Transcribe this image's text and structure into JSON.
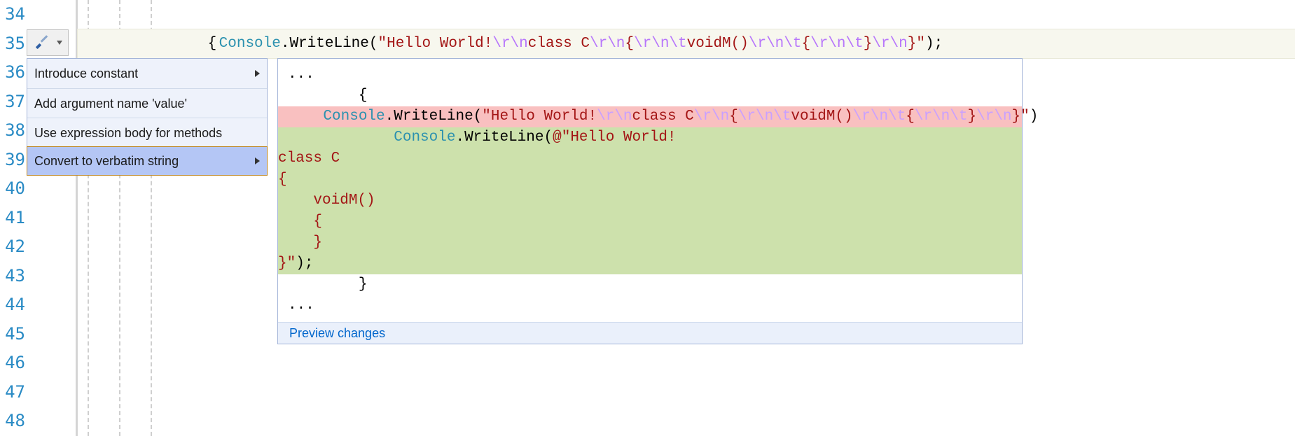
{
  "gutter": {
    "lines": [
      "34",
      "35",
      "36",
      "37",
      "38",
      "39",
      "40",
      "41",
      "42",
      "43",
      "44",
      "45",
      "46",
      "47",
      "48"
    ]
  },
  "code": {
    "line34_brace": "{",
    "line35": {
      "indent": "                ",
      "class": "Console",
      "dot": ".",
      "method": "WriteLine",
      "open": "(",
      "str_open": "\"",
      "s1": "Hello World!",
      "e1": "\\r\\n",
      "s2": "class C",
      "e2": "\\r\\n",
      "s3": "{",
      "e3": "\\r\\n\\t",
      "s4": "voidM()",
      "e4": "\\r\\n\\t",
      "s5": "{",
      "e5": "\\r\\n\\t",
      "s6": "}",
      "e6": "\\r\\n",
      "s7": "}",
      "str_close": "\"",
      "close": ")",
      "semi": ";"
    }
  },
  "bulb": {
    "icon": "screwdriver-icon"
  },
  "menu": {
    "items": [
      {
        "label": "Introduce constant",
        "has_submenu": true,
        "selected": false
      },
      {
        "label": "Add argument name 'value'",
        "has_submenu": false,
        "selected": false
      },
      {
        "label": "Use expression body for methods",
        "has_submenu": false,
        "selected": false
      },
      {
        "label": "Convert to verbatim string",
        "has_submenu": true,
        "selected": true
      }
    ]
  },
  "preview": {
    "ellipsis": "...",
    "brace_open_indented": "        {",
    "del": {
      "indent": "    ",
      "class": "Console",
      "dot": ".",
      "method": "WriteLine",
      "open": "(",
      "q": "\"",
      "s1": "Hello World!",
      "e1": "\\r\\n",
      "s2": "class C",
      "e2": "\\r\\n",
      "s3": "{",
      "e3": "\\r\\n\\t",
      "s4": "voidM()",
      "e4": "\\r\\n\\t",
      "s5": "{",
      "e5": "\\r\\n\\t",
      "s6": "}",
      "e6": "\\r\\n",
      "s7": "}",
      "qclose": "\"",
      "close": ")"
    },
    "add": {
      "line1_prefix": "            ",
      "line1_class": "Console",
      "line1_dot": ".",
      "line1_method": "WriteLine",
      "line1_open": "(",
      "line1_at": "@\"",
      "line1_str": "Hello World!",
      "line2": "class C",
      "line3": "{",
      "line4": "    voidM()",
      "line5": "    {",
      "line6": "    }",
      "line7_str": "}",
      "line7_qclose": "\"",
      "line7_close": ")",
      "line7_semi": ";"
    },
    "brace_close_indented": "        }",
    "footer_link": "Preview changes"
  }
}
